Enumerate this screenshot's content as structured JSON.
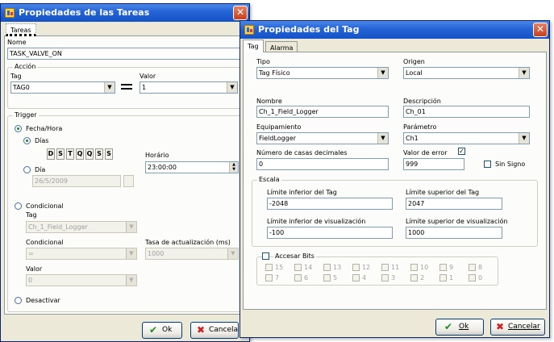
{
  "tasks_window": {
    "title": "Propiedades de las Tareas",
    "tab_label": "Tareas",
    "name_label": "Nome",
    "name_value": "TASK_VALVE_ON",
    "action": {
      "group_label": "Acción",
      "tag_label": "Tag",
      "tag_value": "TAG0",
      "value_label": "Valor",
      "value_value": "1"
    },
    "trigger": {
      "group_label": "Trigger",
      "datetime_label": "Fecha/Hora",
      "days_label": "Días",
      "day_buttons": [
        "D",
        "S",
        "T",
        "Q",
        "Q",
        "S",
        "S"
      ],
      "time_label": "Horário",
      "time_value": "23:00:00",
      "day_label": "Día",
      "date_value": "26/5/2009",
      "conditional_label": "Condicional",
      "cond_tag_label": "Tag",
      "cond_tag_value": "Ch_1_Field_Logger",
      "condition_label": "Condicional",
      "condition_value": "=",
      "rate_label": "Tasa de actualización (ms)",
      "rate_value": "1000",
      "cond_value_label": "Valor",
      "cond_value_value": "0",
      "deactivate_label": "Desactivar"
    },
    "ok_label": "Ok",
    "cancel_label": "Cancelar"
  },
  "tag_window": {
    "title": "Propiedades del Tag",
    "tabs": [
      "Tag",
      "Alarma"
    ],
    "type_label": "Tipo",
    "type_value": "Tag Físico",
    "origin_label": "Origen",
    "origin_value": "Local",
    "name_label": "Nombre",
    "name_value": "Ch_1_Field_Logger",
    "description_label": "Descripción",
    "description_value": "Ch_01",
    "equipment_label": "Equipamiento",
    "equipment_value": "FieldLogger",
    "parameter_label": "Parámetro",
    "parameter_value": "Ch1",
    "decimals_label": "Número de casas decimales",
    "decimals_value": "0",
    "error_value_label": "Valor de error",
    "error_value": "999",
    "unsigned_label": "Sin Signo",
    "scale": {
      "group_label": "Escala",
      "tag_min_label": "Límite inferior del Tag",
      "tag_min_value": "-2048",
      "tag_max_label": "Límite superior del Tag",
      "tag_max_value": "2047",
      "view_min_label": "Límite inferior de visualización",
      "view_min_value": "-100",
      "view_max_label": "Límite superior de visualización",
      "view_max_value": "1000"
    },
    "bits_label": "Accesar Bits",
    "bits_row1": [
      "15",
      "14",
      "13",
      "12",
      "11",
      "10",
      "9",
      "8"
    ],
    "bits_row2": [
      "7",
      "6",
      "5",
      "4",
      "3",
      "2",
      "1",
      "0"
    ],
    "ok_label": "Ok",
    "cancel_label": "Cancelar"
  },
  "icons": {
    "close": "close-icon",
    "dropdown": "chevron-down-icon",
    "ok": "checkmark-icon",
    "cancel": "x-icon"
  }
}
